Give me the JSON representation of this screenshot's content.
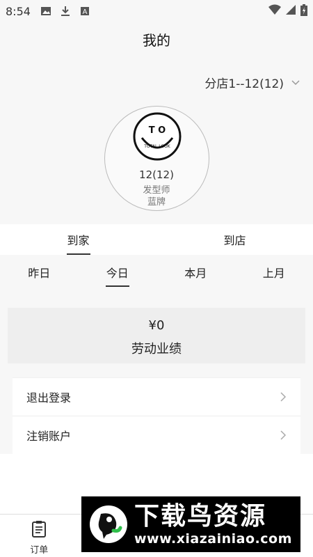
{
  "status_bar": {
    "time": "8:54",
    "icons": [
      "image-icon",
      "download-icon",
      "a-box-icon"
    ],
    "right_icons": [
      "wifi-icon",
      "signal-icon",
      "battery-icon"
    ]
  },
  "header": {
    "title": "我的"
  },
  "store_selector": {
    "label": "分店1--12(12)"
  },
  "profile": {
    "logo_text_top": "T O",
    "logo_text_ring": "TOTAL LOOK",
    "id_label": "12(12)",
    "role": "发型师",
    "level": "蓝牌"
  },
  "service_tabs": [
    {
      "label": "到家",
      "active": true
    },
    {
      "label": "到店",
      "active": false
    }
  ],
  "period_tabs": [
    {
      "label": "昨日",
      "active": false
    },
    {
      "label": "今日",
      "active": true
    },
    {
      "label": "本月",
      "active": false
    },
    {
      "label": "上月",
      "active": false
    }
  ],
  "performance": {
    "value": "¥0",
    "label": "劳动业绩"
  },
  "menu": [
    {
      "label": "退出登录"
    },
    {
      "label": "注销账户"
    }
  ],
  "bottom_nav": [
    {
      "label": "订单",
      "icon": "order-icon"
    }
  ],
  "watermark": {
    "title": "下载鸟资源",
    "url": "www.xiazainiao.com"
  }
}
